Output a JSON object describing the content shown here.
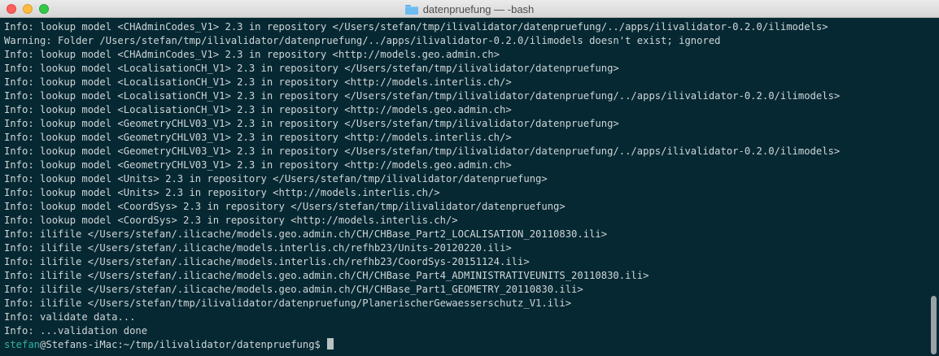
{
  "window": {
    "title": "datenpruefung — -bash",
    "icon": "folder-icon"
  },
  "terminal": {
    "lines": [
      "Info: lookup model <CHAdminCodes_V1> 2.3 in repository </Users/stefan/tmp/ilivalidator/datenpruefung/../apps/ilivalidator-0.2.0/ilimodels>",
      "Warning: Folder /Users/stefan/tmp/ilivalidator/datenpruefung/../apps/ilivalidator-0.2.0/ilimodels doesn't exist; ignored",
      "Info: lookup model <CHAdminCodes_V1> 2.3 in repository <http://models.geo.admin.ch>",
      "Info: lookup model <LocalisationCH_V1> 2.3 in repository </Users/stefan/tmp/ilivalidator/datenpruefung>",
      "Info: lookup model <LocalisationCH_V1> 2.3 in repository <http://models.interlis.ch/>",
      "Info: lookup model <LocalisationCH_V1> 2.3 in repository </Users/stefan/tmp/ilivalidator/datenpruefung/../apps/ilivalidator-0.2.0/ilimodels>",
      "Info: lookup model <LocalisationCH_V1> 2.3 in repository <http://models.geo.admin.ch>",
      "Info: lookup model <GeometryCHLV03_V1> 2.3 in repository </Users/stefan/tmp/ilivalidator/datenpruefung>",
      "Info: lookup model <GeometryCHLV03_V1> 2.3 in repository <http://models.interlis.ch/>",
      "Info: lookup model <GeometryCHLV03_V1> 2.3 in repository </Users/stefan/tmp/ilivalidator/datenpruefung/../apps/ilivalidator-0.2.0/ilimodels>",
      "Info: lookup model <GeometryCHLV03_V1> 2.3 in repository <http://models.geo.admin.ch>",
      "Info: lookup model <Units> 2.3 in repository </Users/stefan/tmp/ilivalidator/datenpruefung>",
      "Info: lookup model <Units> 2.3 in repository <http://models.interlis.ch/>",
      "Info: lookup model <CoordSys> 2.3 in repository </Users/stefan/tmp/ilivalidator/datenpruefung>",
      "Info: lookup model <CoordSys> 2.3 in repository <http://models.interlis.ch/>",
      "Info: ilifile </Users/stefan/.ilicache/models.geo.admin.ch/CH/CHBase_Part2_LOCALISATION_20110830.ili>",
      "Info: ilifile </Users/stefan/.ilicache/models.interlis.ch/refhb23/Units-20120220.ili>",
      "Info: ilifile </Users/stefan/.ilicache/models.interlis.ch/refhb23/CoordSys-20151124.ili>",
      "Info: ilifile </Users/stefan/.ilicache/models.geo.admin.ch/CH/CHBase_Part4_ADMINISTRATIVEUNITS_20110830.ili>",
      "Info: ilifile </Users/stefan/.ilicache/models.geo.admin.ch/CH/CHBase_Part1_GEOMETRY_20110830.ili>",
      "Info: ilifile </Users/stefan/tmp/ilivalidator/datenpruefung/PlanerischerGewaesserschutz_V1.ili>",
      "Info: validate data...",
      "Info: ...validation done"
    ],
    "prompt": {
      "user": "stefan",
      "at_host": "@Stefans-iMac:~/tmp/ilivalidator/datenpruefung$ "
    }
  }
}
